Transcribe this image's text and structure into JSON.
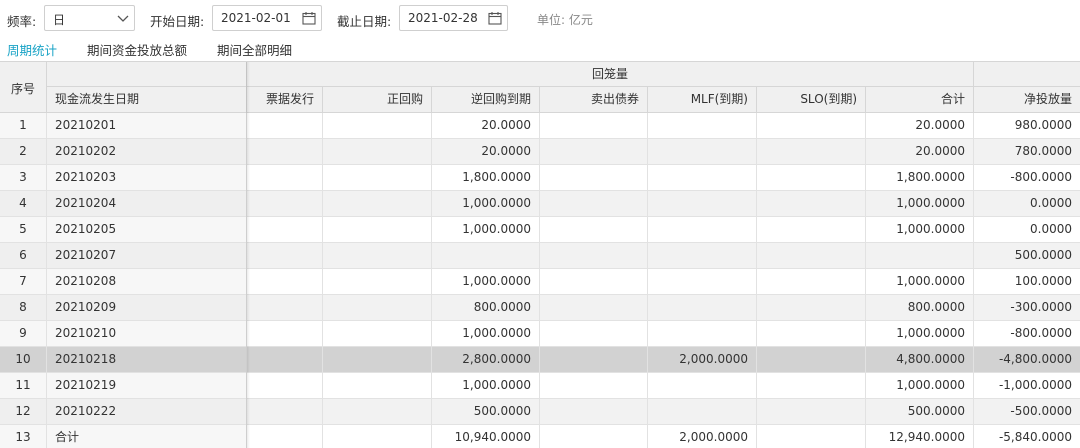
{
  "filters": {
    "frequency_label": "频率:",
    "frequency_value": "日",
    "start_label": "开始日期:",
    "start_value": "2021-02-01",
    "end_label": "截止日期:",
    "end_value": "2021-02-28",
    "unit_text": "单位: 亿元"
  },
  "tabs": [
    {
      "label": "周期统计",
      "active": true
    },
    {
      "label": "期间资金投放总额",
      "active": false
    },
    {
      "label": "期间全部明细",
      "active": false
    }
  ],
  "table": {
    "col_index": "序号",
    "col_date": "现金流发生日期",
    "group_header": "回笼量",
    "columns": [
      "票据发行",
      "正回购",
      "逆回购到期",
      "卖出债券",
      "MLF(到期)",
      "SLO(到期)",
      "合计",
      "净投放量"
    ],
    "selected_row": 9,
    "rows": [
      {
        "idx": "1",
        "date": "20210201",
        "cells": [
          "",
          "",
          "20.0000",
          "",
          "",
          "",
          "20.0000",
          "980.0000"
        ]
      },
      {
        "idx": "2",
        "date": "20210202",
        "cells": [
          "",
          "",
          "20.0000",
          "",
          "",
          "",
          "20.0000",
          "780.0000"
        ]
      },
      {
        "idx": "3",
        "date": "20210203",
        "cells": [
          "",
          "",
          "1,800.0000",
          "",
          "",
          "",
          "1,800.0000",
          "-800.0000"
        ]
      },
      {
        "idx": "4",
        "date": "20210204",
        "cells": [
          "",
          "",
          "1,000.0000",
          "",
          "",
          "",
          "1,000.0000",
          "0.0000"
        ]
      },
      {
        "idx": "5",
        "date": "20210205",
        "cells": [
          "",
          "",
          "1,000.0000",
          "",
          "",
          "",
          "1,000.0000",
          "0.0000"
        ]
      },
      {
        "idx": "6",
        "date": "20210207",
        "cells": [
          "",
          "",
          "",
          "",
          "",
          "",
          "",
          "500.0000"
        ]
      },
      {
        "idx": "7",
        "date": "20210208",
        "cells": [
          "",
          "",
          "1,000.0000",
          "",
          "",
          "",
          "1,000.0000",
          "100.0000"
        ]
      },
      {
        "idx": "8",
        "date": "20210209",
        "cells": [
          "",
          "",
          "800.0000",
          "",
          "",
          "",
          "800.0000",
          "-300.0000"
        ]
      },
      {
        "idx": "9",
        "date": "20210210",
        "cells": [
          "",
          "",
          "1,000.0000",
          "",
          "",
          "",
          "1,000.0000",
          "-800.0000"
        ]
      },
      {
        "idx": "10",
        "date": "20210218",
        "cells": [
          "",
          "",
          "2,800.0000",
          "",
          "2,000.0000",
          "",
          "4,800.0000",
          "-4,800.0000"
        ]
      },
      {
        "idx": "11",
        "date": "20210219",
        "cells": [
          "",
          "",
          "1,000.0000",
          "",
          "",
          "",
          "1,000.0000",
          "-1,000.0000"
        ]
      },
      {
        "idx": "12",
        "date": "20210222",
        "cells": [
          "",
          "",
          "500.0000",
          "",
          "",
          "",
          "500.0000",
          "-500.0000"
        ]
      },
      {
        "idx": "13",
        "date": "合计",
        "cells": [
          "",
          "",
          "10,940.0000",
          "",
          "2,000.0000",
          "",
          "12,940.0000",
          "-5,840.0000"
        ]
      }
    ]
  },
  "icons": {
    "dropdown": "chevron-down-icon",
    "calendar": "calendar-icon"
  },
  "colors": {
    "active_tab": "#1aa3c6",
    "header_bg": "#f0f0f0",
    "selected_row_bg": "#d2d2d2"
  }
}
